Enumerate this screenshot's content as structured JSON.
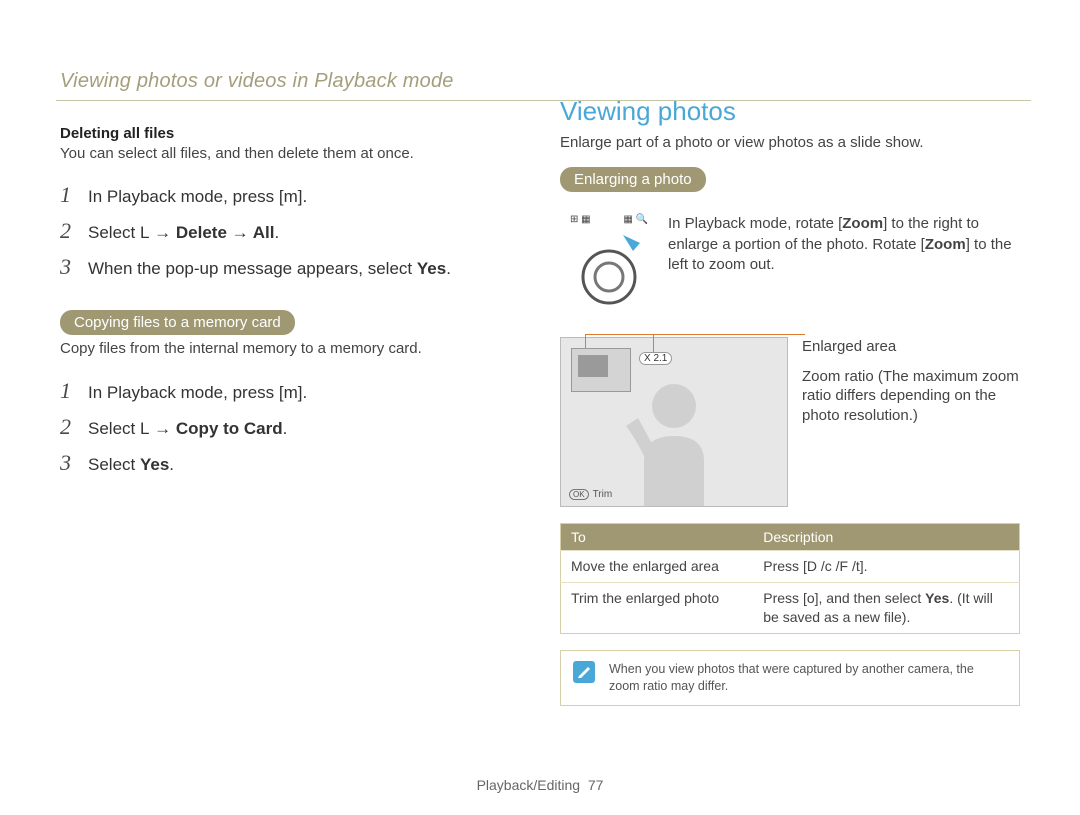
{
  "running_header": "Viewing photos or videos in Playback mode",
  "left": {
    "deleting_heading": "Deleting all files",
    "deleting_desc": "You can select all files, and then delete them at once.",
    "steps_delete": [
      {
        "num": "1",
        "pre": "In Playback mode, press [",
        "icon": "m",
        "post": "]."
      },
      {
        "num": "2",
        "pre": "Select ",
        "icon": "L",
        "bold": " → Delete → All",
        "post": "."
      },
      {
        "num": "3",
        "pre": "When the pop-up message appears, select ",
        "bold": "Yes",
        "post": "."
      }
    ],
    "copy_pill": "Copying files to a memory card",
    "copy_desc": "Copy files from the internal memory to a memory card.",
    "steps_copy": [
      {
        "num": "1",
        "pre": "In Playback mode, press [",
        "icon": "m",
        "post": "]."
      },
      {
        "num": "2",
        "pre": "Select ",
        "icon": "L",
        "bold": " → Copy to Card",
        "post": "."
      },
      {
        "num": "3",
        "pre": "Select ",
        "bold": "Yes",
        "post": "."
      }
    ]
  },
  "right": {
    "title": "Viewing photos",
    "intro": "Enlarge part of a photo or view photos as a slide show.",
    "enlarge_pill": "Enlarging a photo",
    "dial_left_label": "⊞ ▦",
    "dial_right_label": "▦ 🔍",
    "zoom_text_parts": {
      "p1": "In Playback mode, rotate [",
      "zoom": "Zoom",
      "p2": "] to the right to enlarge a portion of the photo. Rotate [",
      "p3": "] to the left to zoom out."
    },
    "ratio_badge": "X 2.1",
    "trim_label": "Trim",
    "ok_label": "OK",
    "callouts": {
      "enlarged_area": "Enlarged area",
      "zoom_ratio": "Zoom ratio (The maximum zoom ratio differs depending on the photo resolution.)"
    },
    "table": {
      "header_to": "To",
      "header_desc": "Description",
      "rows": [
        {
          "to": "Move the enlarged area",
          "desc_pre": "Press [",
          "desc_icons": "D /c /F /t",
          "desc_post": "]."
        },
        {
          "to": "Trim the enlarged photo",
          "desc_pre": "Press [",
          "desc_icons": "o",
          "desc_mid": "], and then select ",
          "desc_bold": "Yes",
          "desc_post": ". (It will be saved as a new file)."
        }
      ]
    },
    "note": "When you view photos that were captured by another camera, the zoom ratio may differ."
  },
  "footer": {
    "section": "Playback/Editing",
    "page": "77"
  }
}
